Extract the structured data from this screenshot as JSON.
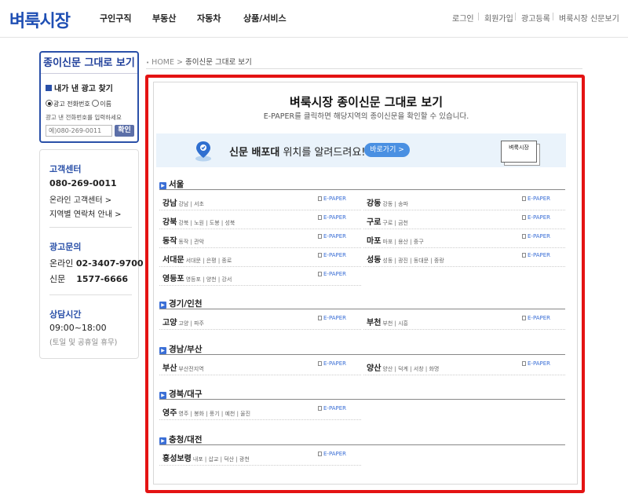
{
  "header": {
    "logo": "벼룩시장",
    "nav": [
      "구인구직",
      "부동산",
      "자동차",
      "상품/서비스"
    ],
    "util": [
      "로그인",
      "회원가입",
      "광고등록",
      "벼룩시장 신문보기"
    ]
  },
  "sidebar": {
    "title": "종이신문 그대로 보기",
    "my_ad": "내가 낸 광고 찾기",
    "radio_phone": "광고 전화번호",
    "radio_name": "이름",
    "hint": "광고 낸 전화번호를 입력하세요",
    "phone_placeholder": "예)080-269-0011",
    "ok": "확인",
    "cs_title": "고객센터",
    "cs_phone": "080-269-0011",
    "cs_online": "온라인 고객센터 >",
    "cs_region": "지역별 연락처 안내 >",
    "ad_title": "광고문의",
    "ad_online_label": "온라인",
    "ad_online_phone": "02-3407-9700",
    "ad_paper_label": "신문",
    "ad_paper_phone": "1577-6666",
    "hours_title": "상담시간",
    "hours": "09:00~18:00",
    "hours_note": "(토일 및 공휴일 휴무)"
  },
  "breadcrumb": {
    "home": "HOME",
    "sep": ">",
    "current": "종이신문 그대로 보기"
  },
  "main": {
    "title": "벼룩시장 종이신문 그대로 보기",
    "subtitle": "E-PAPER를 클릭하면 해당지역의 종이신문을 확인할 수 있습니다.",
    "banner_bold": "신문 배포대",
    "banner_rest": " 위치를 알려드려요!",
    "banner_btn": "바로가기 >",
    "paper_label": "벼룩시장",
    "epaper": "E-PAPER",
    "regions": [
      {
        "title": "서울",
        "items": [
          {
            "name": "강남",
            "sub": "강남 | 서초"
          },
          {
            "name": "강동",
            "sub": "강동 | 송파"
          },
          {
            "name": "강북",
            "sub": "강북 | 노원 | 도봉 | 성북"
          },
          {
            "name": "구로",
            "sub": "구로 | 금천"
          },
          {
            "name": "동작",
            "sub": "동작 | 관악"
          },
          {
            "name": "마포",
            "sub": "마포 | 용산 | 중구"
          },
          {
            "name": "서대문",
            "sub": "서대문 | 은평 | 종로"
          },
          {
            "name": "성동",
            "sub": "성동 | 광진 | 동대문 | 중랑"
          },
          {
            "name": "영등포",
            "sub": "영등포 | 양천 | 강서"
          }
        ]
      },
      {
        "title": "경기/인천",
        "items": [
          {
            "name": "고양",
            "sub": "고양 | 파주"
          },
          {
            "name": "부천",
            "sub": "부천 | 시흥"
          }
        ]
      },
      {
        "title": "경남/부산",
        "items": [
          {
            "name": "부산",
            "sub": "부산전지역"
          },
          {
            "name": "양산",
            "sub": "양산 | 덕계 | 서창 | 화명"
          }
        ]
      },
      {
        "title": "경북/대구",
        "items": [
          {
            "name": "영주",
            "sub": "영주 | 봉화 | 풍기 | 예천 | 울진"
          }
        ]
      },
      {
        "title": "충청/대전",
        "items": [
          {
            "name": "홍성보령",
            "sub": "내포 | 삽교 | 덕산 | 광천"
          }
        ]
      }
    ]
  },
  "colors": {
    "brand": "#1f4fb4",
    "highlight_border": "#e41313",
    "accent": "#4a90e2"
  }
}
